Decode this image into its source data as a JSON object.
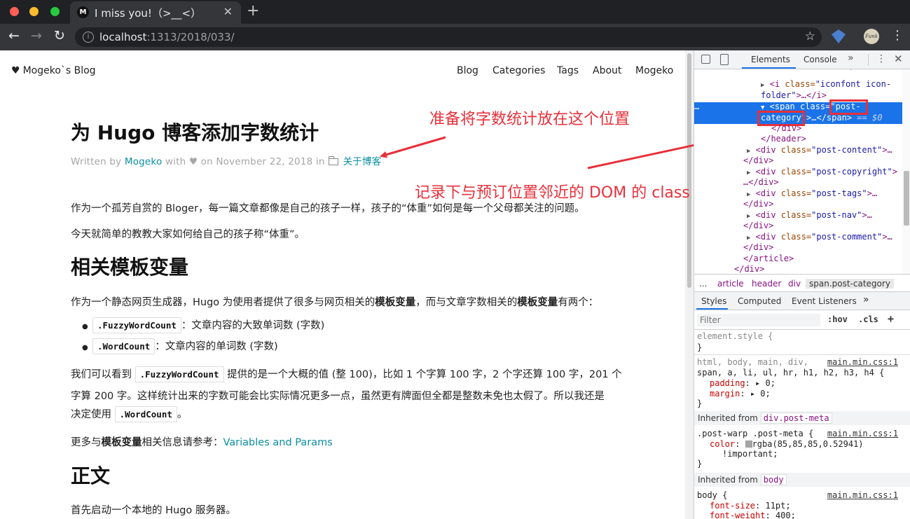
{
  "browser": {
    "tab_title": "I miss you!（>__<）",
    "favicon_letter": "M",
    "url_host": "localhost",
    "url_path": ":1313/2018/033/",
    "extension_badge": "Funk"
  },
  "site": {
    "brand": "Mogeko`s Blog",
    "nav": [
      "Blog",
      "Categories",
      "Tags",
      "About",
      "Mogeko"
    ]
  },
  "post": {
    "title": "为 Hugo 博客添加字数统计",
    "meta_written_by": "Written by",
    "meta_author": "Mogeko",
    "meta_with": "with ♥ on November 22, 2018 in",
    "meta_category": "关于博客",
    "intro_1": "作为一个孤芳自赏的 Bloger，每一篇文章都像是自己的孩子一样，孩子的“体重”如何是每一个父母都关注的问题。",
    "intro_2": "今天就简单的教教大家如何给自己的孩子称“体重”。",
    "h2_vars": "相关模板变量",
    "vars_p_a": "作为一个静态网页生成器，Hugo 为使用者提供了很多与网页相关的",
    "vars_p_b": "模板变量",
    "vars_p_c": "，而与文章字数相关的",
    "vars_p_d": "模板变量",
    "vars_p_e": "有两个：",
    "li1_code": ".FuzzyWordCount",
    "li1_text": "：文章内容的大致单词数 (字数)",
    "li2_code": ".WordCount",
    "li2_text": "：文章内容的单词数 (字数)",
    "p3_a": "我们可以看到",
    "p3_code": ".FuzzyWordCount",
    "p3_b": "提供的是一个大概的值 (整 100)，比如 1 个字算 100 字，2 个字还算 100 字，201 个",
    "p3_line2": "字算 200 字。这样统计出来的字数可能会比实际情况更多一点，虽然更有牌面但全都是整数未免也太假了。所以我还是",
    "p3_line3_a": "决定使用",
    "p3_line3_code": ".WordCount",
    "p3_line3_b": "。",
    "more_a": "更多与",
    "more_b": "模板变量",
    "more_c": "相关信息请参考：",
    "more_link": "Variables and Params",
    "h2_main": "正文",
    "main_p": "首先启动一个本地的 Hugo 服务器。"
  },
  "annotations": {
    "top": "准备将字数统计放在这个位置",
    "bottom": "记录下与预订位置邻近的 DOM 的 class 值"
  },
  "devtools": {
    "tabs": [
      "Elements",
      "Console"
    ],
    "more": "»",
    "dom_quote": "\"",
    "dom": {
      "l1_tag": "<i",
      "l1_attr": "class=",
      "l1_val": "\"iconfont icon-",
      "l2_val": "folder\"",
      "l2_rest": ">…</i>",
      "sel_dots": "…",
      "sel_tag": "<span",
      "sel_attr": "class=",
      "sel_val1": "\"post-",
      "sel_val2": "category\"",
      "sel_rest": ">…</span>",
      "sel_dollar": "== $0",
      "div_close": "</div>",
      "header_close": "</header>",
      "content_val": "\"post-content\"",
      "copyright_val": "\"post-copyright\"",
      "tags_val": "\"post-tags\"",
      "nav_val": "\"post-nav\"",
      "comment_val": "\"post-comment\"",
      "article_close": "</article>",
      "div_open": "<div",
      "class_attr": "class=",
      "ell": ">…",
      "ell2": "…</div>",
      "gt": ">"
    },
    "breadcrumbs": [
      "...",
      "article",
      "header",
      "div",
      "span.post-category"
    ],
    "style_tabs": [
      "Styles",
      "Computed",
      "Event Listeners"
    ],
    "filter_placeholder": "Filter",
    "hov": ":hov",
    "cls": ".cls",
    "plus": "+",
    "rules": {
      "element_style": "element.style {",
      "close": "}",
      "r2_sel1": "html, body, main, div,",
      "r2_src": "main.min.css:1",
      "r2_sel2": "span, a, li, ul, hr, h1, h2, h3, h4 {",
      "padding": "padding",
      "margin": "margin",
      "zero": "▸ 0;",
      "inherited_from": "Inherited from",
      "inh1_tag": "div.post-meta",
      "r3_sel": ".post-warp .post-meta {",
      "r3_src": "main.min.css:1",
      "color": "color",
      "color_val": "rgba(85,85,85,0.52941)",
      "important": "!important;",
      "inh2_tag": "body",
      "r4_sel": "body {",
      "r4_src": "main.min.css:1",
      "font_size": "font-size",
      "font_size_val": "11pt;",
      "font_weight": "font-weight",
      "font_weight_val": "400;"
    }
  },
  "colors": {
    "annotation_red": "#e8303a",
    "link_teal": "#0a8ea0",
    "devtools_blue": "#1a73e8"
  }
}
